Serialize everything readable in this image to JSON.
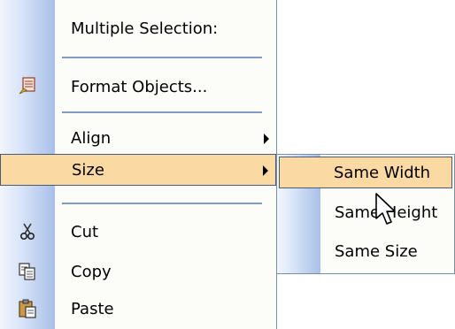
{
  "main_menu": {
    "header": "Multiple Selection:",
    "format_objects": "Format Objects...",
    "align": "Align",
    "size": "Size",
    "cut": "Cut",
    "copy": "Copy",
    "paste": "Paste"
  },
  "size_submenu": {
    "same_width": "Same Width",
    "same_height": "Same Height",
    "same_size": "Same Size"
  },
  "colors": {
    "highlight": "#fbd9a3",
    "separator": "#7f9ac3",
    "gutter_dark": "#a9c0e8"
  },
  "icons": [
    "format-objects-icon",
    "cut-icon",
    "copy-icon",
    "paste-icon",
    "submenu-arrow-icon",
    "mouse-pointer-icon"
  ]
}
